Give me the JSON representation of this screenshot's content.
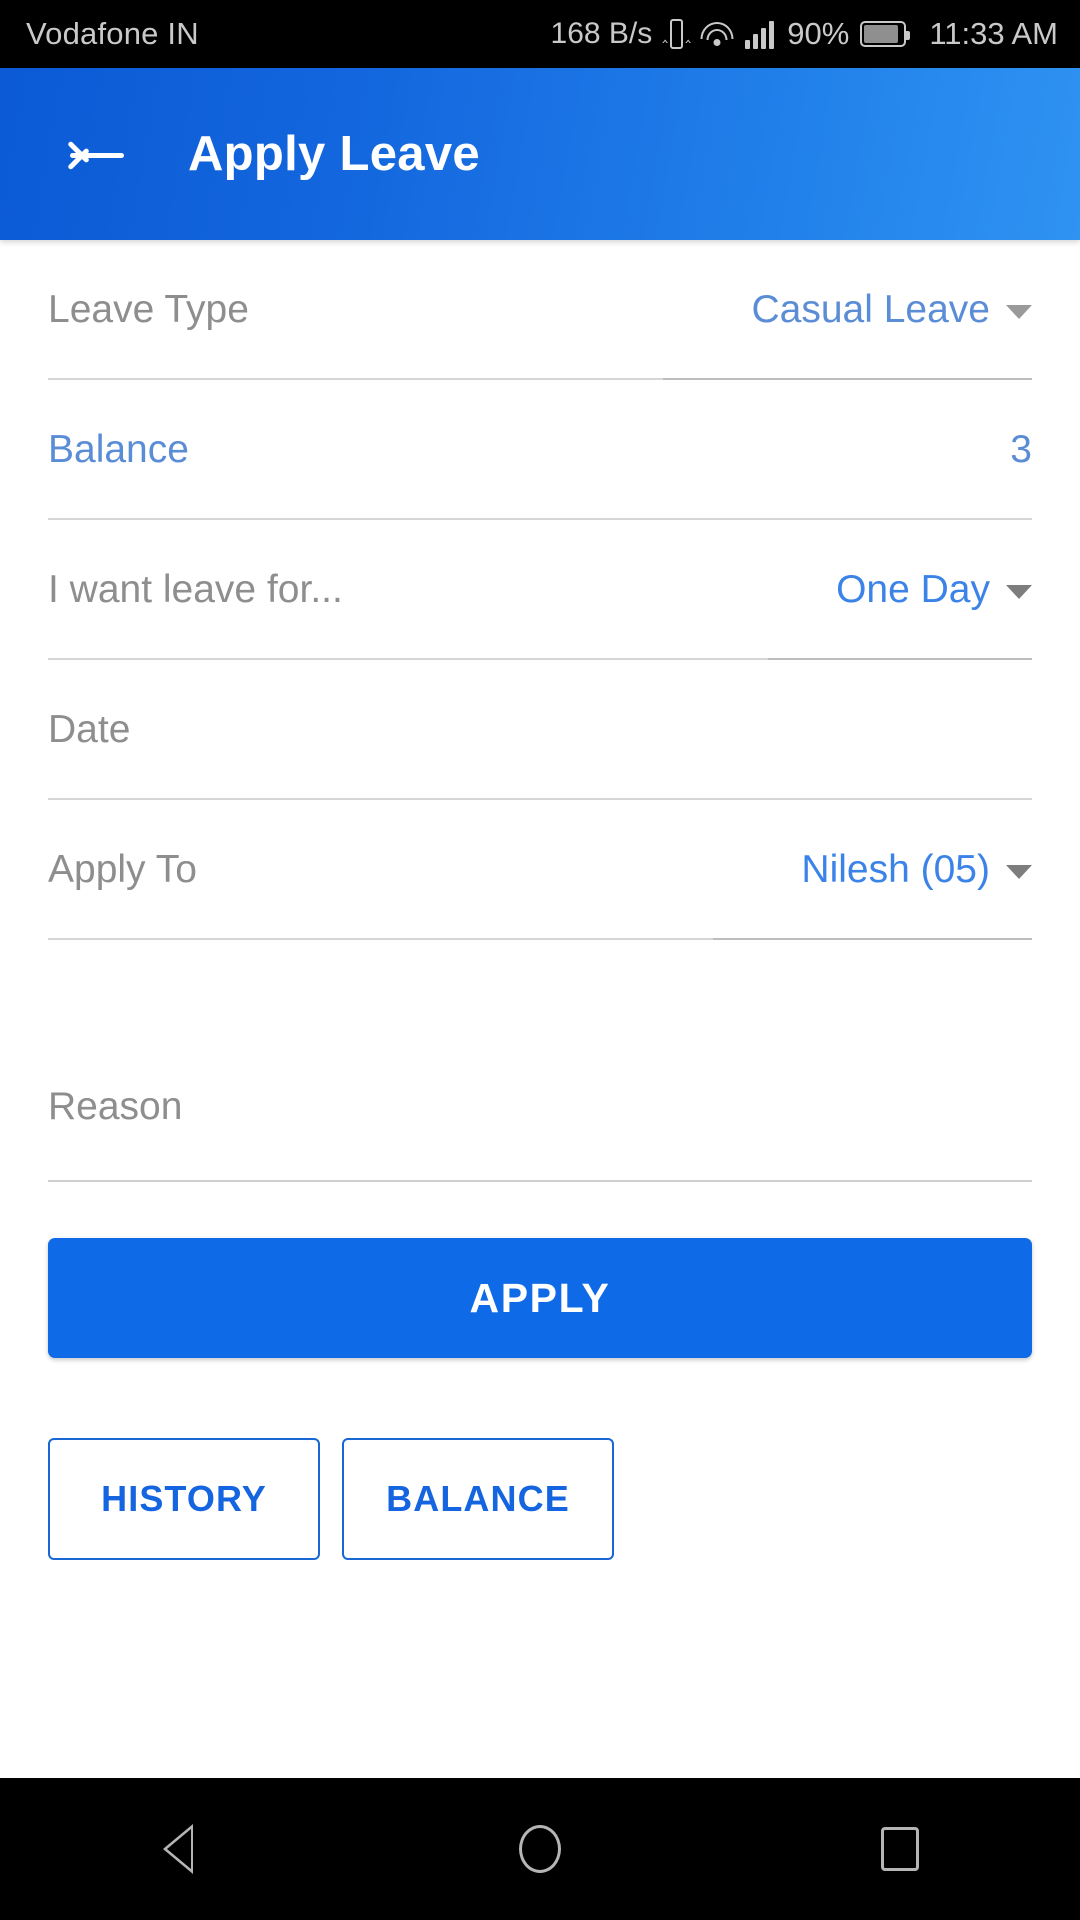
{
  "status_bar": {
    "carrier": "Vodafone IN",
    "net_speed": "168 B/s",
    "battery_percent": "90%",
    "time": "11:33 AM",
    "icons": [
      "vibrate-icon",
      "wifi-icon",
      "signal-bars-icon",
      "battery-icon"
    ]
  },
  "app_bar": {
    "back_icon": "back-arrow-icon",
    "title": "Apply Leave"
  },
  "form": {
    "rows": [
      {
        "label": "Leave Type",
        "value": "Casual Leave",
        "has_caret": true,
        "label_color": "#8e8e8e",
        "value_color": "#5b8dd6"
      },
      {
        "label": "Balance",
        "value": "3",
        "has_caret": false,
        "label_color": "#5b8dd6",
        "value_color": "#5b8dd6"
      },
      {
        "label": "I want leave for...",
        "value": "One Day",
        "has_caret": true,
        "label_color": "#8e8e8e",
        "value_color": "#3c83e8"
      },
      {
        "label": "Date",
        "value": "",
        "has_caret": false,
        "label_color": "#8e8e8e",
        "value_color": "#5b8dd6"
      },
      {
        "label": "Apply To",
        "value": "Nilesh (05)",
        "has_caret": true,
        "label_color": "#8e8e8e",
        "value_color": "#3c83e8"
      }
    ],
    "reason": {
      "placeholder": "Reason",
      "value": ""
    }
  },
  "actions": {
    "apply_label": "APPLY",
    "history_label": "HISTORY",
    "balance_label": "BALANCE"
  },
  "nav_bar": {
    "back": "nav-back-icon",
    "home": "nav-home-icon",
    "recents": "nav-recents-icon"
  },
  "colors": {
    "appbar_gradient_start": "#0c5ad6",
    "appbar_gradient_end": "#2f93f2",
    "primary_button": "#0f6ae8",
    "outline_button_border": "#1967d2",
    "link_blue": "#3c83e8",
    "label_gray": "#8e8e8e"
  }
}
